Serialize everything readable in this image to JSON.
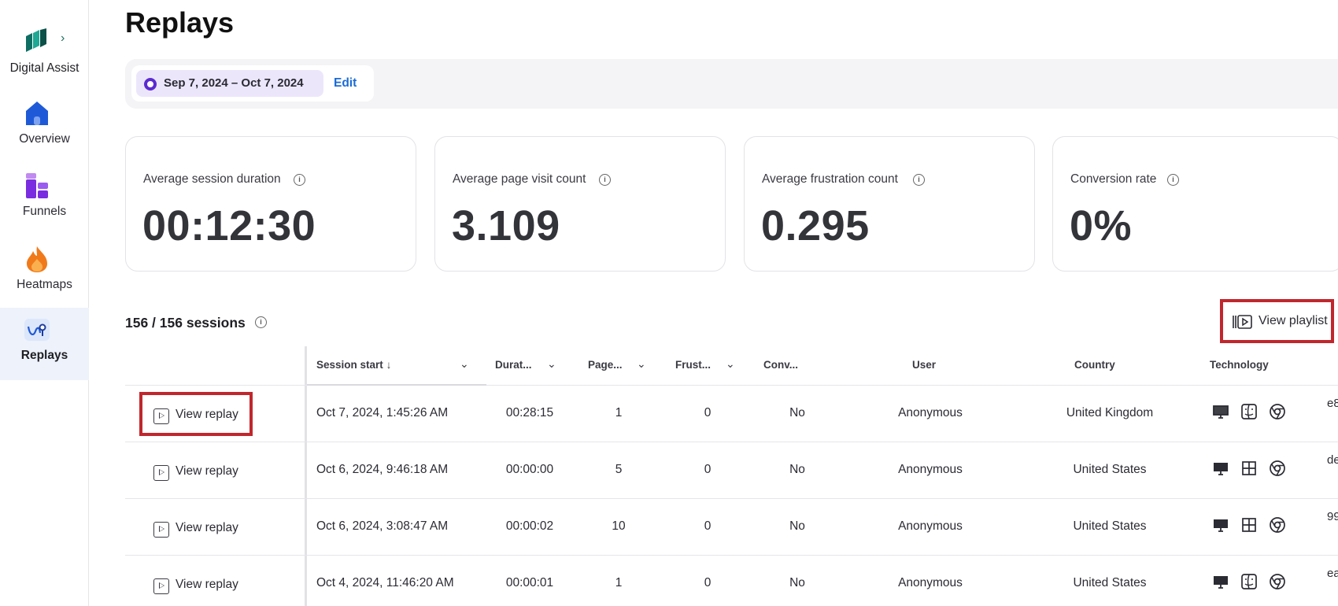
{
  "sidebar": {
    "brand_label": "Digital Assist",
    "items": [
      {
        "label": "Overview",
        "icon": "home-icon",
        "active": false
      },
      {
        "label": "Funnels",
        "icon": "funnel-grid-icon",
        "active": false
      },
      {
        "label": "Heatmaps",
        "icon": "flame-icon",
        "active": false
      },
      {
        "label": "Replays",
        "icon": "replay-path-icon",
        "active": true
      }
    ]
  },
  "page": {
    "title": "Replays"
  },
  "filter": {
    "date_range": "Sep 7, 2024 – Oct 7, 2024",
    "edit_label": "Edit"
  },
  "metrics": [
    {
      "label": "Average session duration",
      "value": "00:12:30"
    },
    {
      "label": "Average page visit count",
      "value": "3.109"
    },
    {
      "label": "Average frustration count",
      "value": "0.295"
    },
    {
      "label": "Conversion rate",
      "value": "0%"
    }
  ],
  "sessions": {
    "title": "156 / 156 sessions",
    "playlist_label": "View playlist"
  },
  "table": {
    "headers": {
      "session_start": "Session start",
      "duration": "Durat...",
      "pages": "Page...",
      "frustration": "Frust...",
      "conversion": "Conv...",
      "user": "User",
      "country": "Country",
      "technology": "Technology"
    },
    "rows": [
      {
        "action": "View replay",
        "session_start": "Oct 7, 2024, 1:45:26 AM",
        "duration": "00:28:15",
        "pages": "1",
        "frustration": "0",
        "conversion": "No",
        "user": "Anonymous",
        "country": "United Kingdom",
        "os_icon": "finder-icon",
        "trunc": "e8"
      },
      {
        "action": "View replay",
        "session_start": "Oct 6, 2024, 9:46:18 AM",
        "duration": "00:00:00",
        "pages": "5",
        "frustration": "0",
        "conversion": "No",
        "user": "Anonymous",
        "country": "United States",
        "os_icon": "windows-icon",
        "trunc": "de"
      },
      {
        "action": "View replay",
        "session_start": "Oct 6, 2024, 3:08:47 AM",
        "duration": "00:00:02",
        "pages": "10",
        "frustration": "0",
        "conversion": "No",
        "user": "Anonymous",
        "country": "United States",
        "os_icon": "windows-icon",
        "trunc": "99"
      },
      {
        "action": "View replay",
        "session_start": "Oct 4, 2024, 11:46:20 AM",
        "duration": "00:00:01",
        "pages": "1",
        "frustration": "0",
        "conversion": "No",
        "user": "Anonymous",
        "country": "United States",
        "os_icon": "finder-icon",
        "trunc": "ea"
      }
    ]
  },
  "colors": {
    "accent_blue": "#1a6bd6",
    "date_chip_bg": "#ece6fb",
    "date_dot": "#5b2bd1",
    "highlight_red": "#c0272d",
    "active_nav_bg": "#edf2fb"
  }
}
